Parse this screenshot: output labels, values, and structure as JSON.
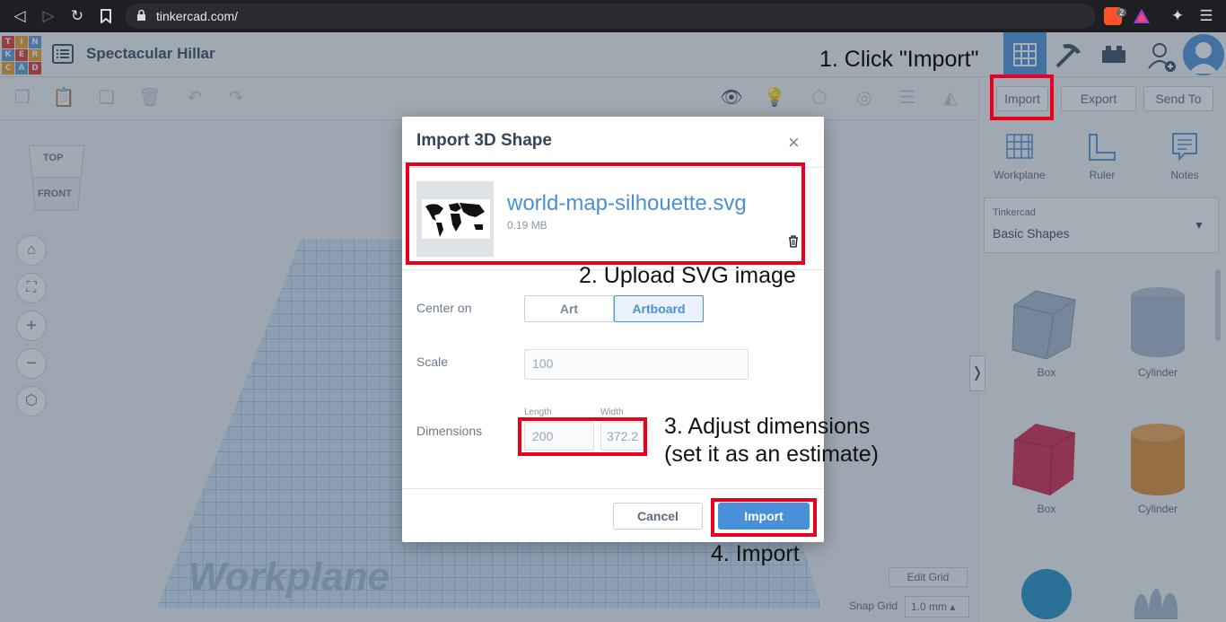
{
  "browser": {
    "url": "tinkercad.com/",
    "ext_badge": "2"
  },
  "logo": {
    "letters": [
      "T",
      "I",
      "N",
      "K",
      "E",
      "R",
      "C",
      "A",
      "D"
    ]
  },
  "header": {
    "title": "Spectacular Hillar"
  },
  "panel": {
    "import_label": "Import",
    "export_label": "Export",
    "send_to_label": "Send To",
    "tools": [
      "Workplane",
      "Ruler",
      "Notes"
    ],
    "library_source": "Tinkercad",
    "library_name": "Basic Shapes",
    "shapes": [
      "Box",
      "Cylinder",
      "Box",
      "Cylinder"
    ]
  },
  "viewcube": {
    "top": "TOP",
    "front": "FRONT"
  },
  "canvas": {
    "workplane_label": "Workplane",
    "edit_grid": "Edit Grid",
    "snap_grid_label": "Snap Grid",
    "snap_grid_value": "1.0 mm"
  },
  "modal": {
    "title": "Import 3D Shape",
    "file_name": "world-map-silhouette.svg",
    "file_size": "0.19 MB",
    "center_on_label": "Center on",
    "center_art": "Art",
    "center_artboard": "Artboard",
    "scale_label": "Scale",
    "scale_value": "100",
    "dimensions_label": "Dimensions",
    "length_label": "Length",
    "width_label": "Width",
    "length_value": "200",
    "width_value": "372.2",
    "cancel_label": "Cancel",
    "import_label": "Import"
  },
  "annotations": {
    "step1": "1. Click \"Import\"",
    "step2": "2. Upload SVG image",
    "step3_line1": "3. Adjust dimensions",
    "step3_line2": "(set it as an estimate)",
    "step4": "4. Import"
  },
  "colors": {
    "accent": "#4a90d9",
    "annotation_red": "#e8001c"
  }
}
